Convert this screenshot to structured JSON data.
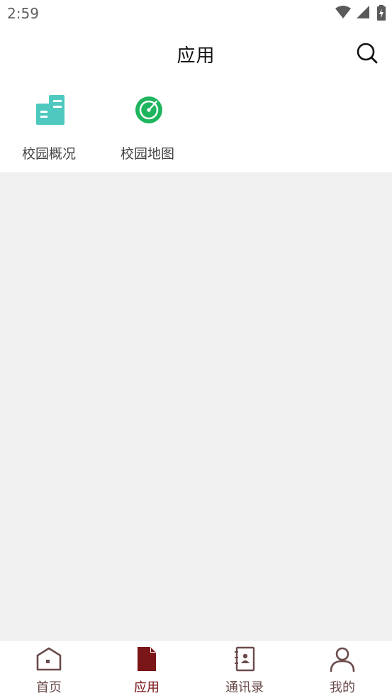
{
  "status_bar": {
    "time": "2:59",
    "icons": [
      "wifi-icon",
      "cell-signal-icon",
      "battery-charging-icon"
    ]
  },
  "header": {
    "title": "应用",
    "search_icon": "search-icon"
  },
  "apps": [
    {
      "label": "校园概况",
      "icon": "building-icon",
      "color": "#4fc9c0"
    },
    {
      "label": "校园地图",
      "icon": "radar-map-icon",
      "color": "#1db55d"
    }
  ],
  "bottom_nav": {
    "items": [
      {
        "label": "首页",
        "icon": "home-icon",
        "active": false
      },
      {
        "label": "应用",
        "icon": "document-icon",
        "active": true
      },
      {
        "label": "通讯录",
        "icon": "contacts-book-icon",
        "active": false
      },
      {
        "label": "我的",
        "icon": "person-icon",
        "active": false
      }
    ],
    "active_color": "#7a1518",
    "inactive_color": "#6b4b4b"
  },
  "colors": {
    "content_background": "#f0f0f0",
    "page_background": "#ffffff"
  }
}
